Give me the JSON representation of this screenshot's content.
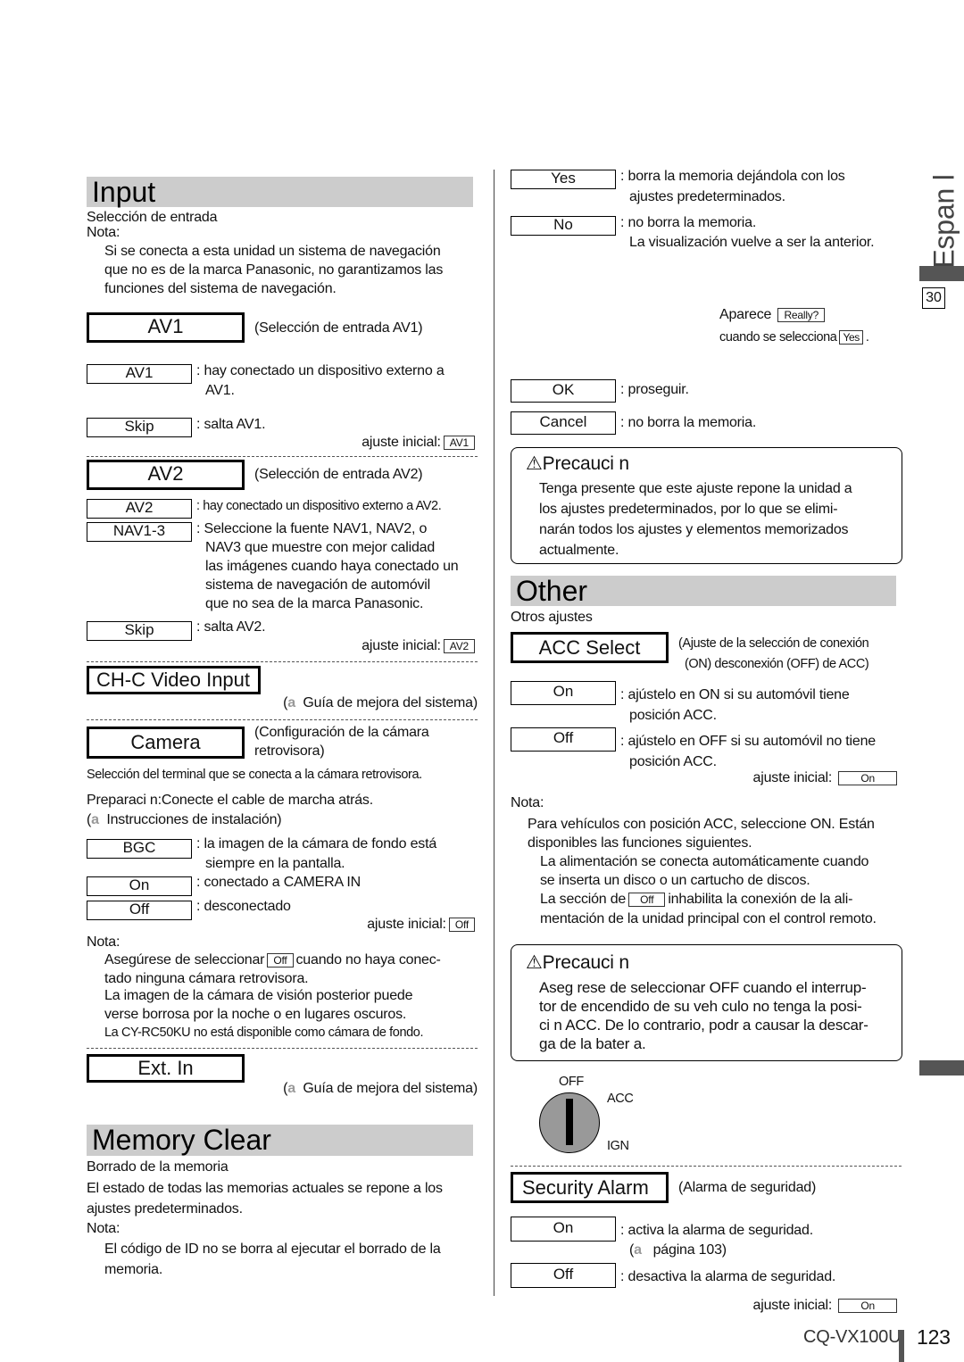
{
  "input": {
    "title": "Input",
    "subtitle": "Selección de entrada",
    "nota": "Nota:",
    "note_lines": [
      "Si se conecta a esta unidad un sistema de navegación",
      "que no es de la marca Panasonic, no garantizamos las",
      "funciones del sistema de navegación."
    ],
    "av1": {
      "label": "AV1",
      "caption": "(Selección de entrada AV1)",
      "opt1": "AV1",
      "opt1_desc": ": hay conectado un dispositivo externo a",
      "opt1_desc2": "AV1.",
      "opt2": "Skip",
      "opt2_desc": ": salta AV1.",
      "initial_label": "ajuste inicial:",
      "initial": "AV1"
    },
    "av2": {
      "label": "AV2",
      "caption": "(Selección de entrada AV2)",
      "opt1": "AV2",
      "opt1_desc": ": hay conectado un dispositivo externo a AV2.",
      "opt2": "NAV1-3",
      "opt2_lines": [
        ": Seleccione la fuente NAV1, NAV2, o",
        "NAV3 que muestre con mejor calidad",
        "las imágenes cuando haya conectado un",
        "sistema de navegación de automóvil",
        "que no sea de la marca Panasonic."
      ],
      "opt3": "Skip",
      "opt3_desc": ": salta AV2.",
      "initial_label": "ajuste inicial:",
      "initial": "AV2"
    },
    "chc": {
      "label": "CH-C Video Input",
      "ref_a": "a",
      "ref": "Guía de mejora del sistema)",
      "ref_open": "("
    },
    "camera": {
      "label": "Camera",
      "caption1": "(Configuración de la cámara",
      "caption2": "retrovisora)",
      "desc": "Selección del terminal que se conecta a la cámara retrovisora.",
      "prep": "Preparaci n:Conecte el cable de marcha atrás.",
      "prep_ref": "Instrucciones de instalación)",
      "opt1": "BGC",
      "opt1_desc": ": la imagen de la cámara de fondo está",
      "opt1_desc2": "siempre en la pantalla.",
      "opt2": "On",
      "opt2_desc": ": conectado a CAMERA IN",
      "opt3": "Off",
      "opt3_desc": ": desconectado",
      "initial_label": "ajuste inicial:",
      "initial": "Off",
      "nota": "Nota:",
      "note1a": "Asegúrese de seleccionar",
      "note1_box": "Off",
      "note1b": "cuando no haya conec-",
      "note2": "tado ninguna cámara retrovisora.",
      "note3": "La imagen de la cámara de visión posterior puede",
      "note4": "verse borrosa por la noche o en lugares oscuros.",
      "note5": "La CY-RC50KU no está disponible como cámara de fondo."
    },
    "extin": {
      "label": "Ext. In",
      "ref": "Guía de mejora del sistema)"
    }
  },
  "memory": {
    "title": "Memory Clear",
    "subtitle": "Borrado de la memoria",
    "lines": [
      "El estado de todas las memorias actuales se repone a los",
      "ajustes predeterminados."
    ],
    "nota": "Nota:",
    "note_lines": [
      "El código de ID no se borra al ejecutar el borrado de la",
      "memoria."
    ],
    "yes": "Yes",
    "yes_desc": ": borra la memoria dejándola con los",
    "yes_desc2": "ajustes predeterminados.",
    "no": "No",
    "no_desc": ": no borra la memoria.",
    "no_desc2": "La visualización vuelve a ser la anterior.",
    "appears": "Aparece",
    "really": "Really?",
    "when": "cuando se selecciona",
    "when_box": "Yes",
    "ok": "OK",
    "ok_desc": ": proseguir.",
    "cancel": "Cancel",
    "cancel_desc": ": no borra la memoria."
  },
  "caution1": {
    "title": "Precauci n",
    "lines": [
      "Tenga presente que este ajuste repone la unidad a",
      "los ajustes predeterminados, por lo que se elimi-",
      "narán todos los ajustes y elementos memorizados",
      "actualmente."
    ]
  },
  "other": {
    "title": "Other",
    "subtitle": "Otros ajustes",
    "acc": {
      "label": "ACC Select",
      "caption1": "(Ajuste de la selección de conexión",
      "caption2": "(ON) desconexión (OFF) de ACC)",
      "opt1": "On",
      "opt1_desc": ": ajústelo en ON si su automóvil tiene",
      "opt1_desc2": "posición ACC.",
      "opt2": "Off",
      "opt2_desc": ": ajústelo en OFF si su automóvil no tiene",
      "opt2_desc2": "posición ACC.",
      "initial_label": "ajuste inicial:",
      "initial": "On",
      "nota": "Nota:",
      "note1": "Para vehículos con posición ACC, seleccione ON. Están",
      "note2": "disponibles las funciones siguientes.",
      "note3": "La alimentación se conecta automáticamente cuando",
      "note4": "se inserta un disco o un cartucho de discos.",
      "note5a": "La sección de",
      "note5_box": "Off",
      "note5b": "inhabilita la conexión de la ali-",
      "note6": "mentación de la unidad principal con el control remoto."
    },
    "switch": {
      "off": "OFF",
      "acc": "ACC",
      "ign": "IGN"
    },
    "alarm": {
      "label": "Security Alarm",
      "caption": "(Alarma de seguridad)",
      "opt1": "On",
      "opt1_desc": ": activa la alarma de seguridad.",
      "opt1_ref": "página 103)",
      "opt2": "Off",
      "opt2_desc": ": desactiva la alarma de seguridad.",
      "initial_label": "ajuste inicial:",
      "initial": "On"
    }
  },
  "caution2": {
    "title": "Precauci n",
    "lines": [
      "Aseg rese de seleccionar OFF cuando el interrup-",
      "tor de encendido de su veh culo no tenga la posi-",
      "ci n ACC. De lo contrario, podr a causar la descar-",
      "ga de la bater a."
    ]
  },
  "side": {
    "language": "Espan l",
    "section": "30"
  },
  "footer": {
    "model": "CQ-VX100U",
    "page": "123"
  },
  "colors": {
    "header_bar": "#cccccc",
    "side_bar": "#555555",
    "ref_arrow": "#999999"
  }
}
